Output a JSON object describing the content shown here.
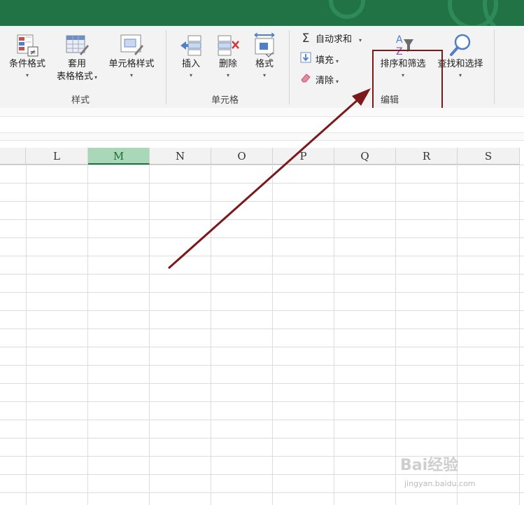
{
  "ribbon": {
    "styles_group": {
      "name": "样式",
      "conditional_format": "条件格式",
      "table_format_line1": "套用",
      "table_format_line2": "表格格式",
      "cell_styles": "单元格样式"
    },
    "cells_group": {
      "name": "单元格",
      "insert": "插入",
      "delete": "删除",
      "format": "格式"
    },
    "editing_group": {
      "name": "编辑",
      "autosum": "自动求和",
      "fill": "填充",
      "clear": "清除",
      "sort_filter": "排序和筛选",
      "find_select": "查找和选择"
    },
    "dropdown_glyph": "▾"
  },
  "columns": [
    "L",
    "M",
    "N",
    "O",
    "P",
    "Q",
    "R",
    "S"
  ],
  "selected_column": "M",
  "watermark": {
    "logo": "Bai经验",
    "url": "jingyan.baidu.com"
  },
  "colors": {
    "title_bar": "#217346",
    "selected_column_fill": "#a9d8b8",
    "highlight_box": "#7a1a1a",
    "arrow": "#7a1a1a"
  },
  "icons": [
    "conditional-format-icon",
    "table-format-icon",
    "cell-styles-icon",
    "insert-cells-icon",
    "delete-cells-icon",
    "format-cells-icon",
    "sigma-icon",
    "fill-down-icon",
    "eraser-icon",
    "sort-filter-icon",
    "magnifier-icon"
  ]
}
